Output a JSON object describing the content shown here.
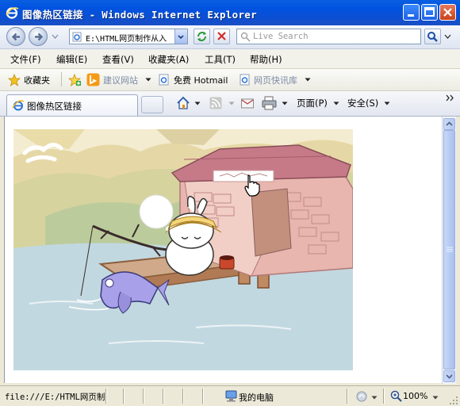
{
  "window": {
    "title": "图像热区链接 - Windows Internet Explorer"
  },
  "navigation": {
    "address": "E:\\HTML网页制作从入",
    "search_placeholder": "Live Search"
  },
  "menu": {
    "items": [
      "文件(F)",
      "编辑(E)",
      "查看(V)",
      "收藏夹(A)",
      "工具(T)",
      "帮助(H)"
    ]
  },
  "favorites": {
    "favorites_label": "收藏夹",
    "suggested_sites": "建议网站",
    "hotmail": "免费 Hotmail",
    "web_slice": "网页快讯库"
  },
  "tab": {
    "label": "图像热区链接"
  },
  "commands": {
    "page": "页面(P)",
    "safety": "安全(S)"
  },
  "status": {
    "url": "file:///E:/HTML网页制",
    "zone": "我的电脑",
    "zoom": "100%"
  },
  "colors": {
    "titlebar": "#0a5fe0",
    "water": "#c2d8e0",
    "fish": "#a8a0e8",
    "roof": "#c67a88"
  }
}
